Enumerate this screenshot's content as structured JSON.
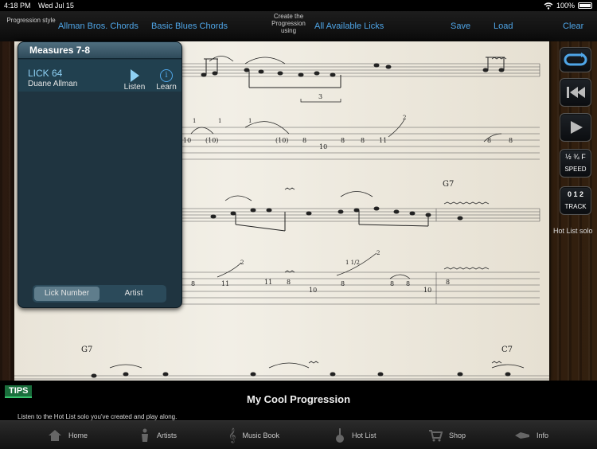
{
  "status": {
    "time": "4:18 PM",
    "date": "Wed Jul 15",
    "battery": "100%"
  },
  "topbar": {
    "progression_label": "Progression style",
    "style_allman": "Allman Bros. Chords",
    "style_blues": "Basic Blues Chords",
    "create_label": "Create the Progression using",
    "all_licks": "All Available Licks",
    "save": "Save",
    "load": "Load",
    "clear": "Clear"
  },
  "sheet": {
    "chord_1": "G7",
    "chord_2": "G7",
    "chord_3": "C7",
    "triplet": "3",
    "tab_row1": [
      "10",
      "(10)",
      "(10)",
      "8",
      "10",
      "8",
      "8",
      "11",
      "8",
      "8"
    ],
    "tab_row2": [
      "8",
      "11",
      "11",
      "8",
      "10",
      "8",
      "8",
      "8",
      "10",
      "8"
    ],
    "bends_row1": [
      "1",
      "1",
      "1",
      "2"
    ],
    "bends_row2": [
      "2",
      "1 1/2",
      "2"
    ]
  },
  "panel": {
    "header": "Measures 7-8",
    "lick_title": "LICK 64",
    "lick_artist": "Duane Allman",
    "listen": "Listen",
    "learn": "Learn",
    "learn_glyph": "i",
    "seg_lick_number": "Lick Number",
    "seg_artist": "Artist"
  },
  "right": {
    "speed_label": "SPEED",
    "speed_values": "½ ¾ F",
    "track_label": "TRACK",
    "track_values": "0 1 2",
    "hotlist_caption": "Hot List solo"
  },
  "footer": {
    "tips": "TIPS",
    "title": "My Cool Progression",
    "tip_text": "Listen to the Hot List solo you've created and play along."
  },
  "tabs": [
    {
      "label": "Home",
      "icon": "home-icon"
    },
    {
      "label": "Artists",
      "icon": "guitarist-icon"
    },
    {
      "label": "Music Book",
      "icon": "treble-clef-icon"
    },
    {
      "label": "Hot List",
      "icon": "guitar-icon"
    },
    {
      "label": "Shop",
      "icon": "cart-icon"
    },
    {
      "label": "Info",
      "icon": "info-icon"
    }
  ],
  "colors": {
    "accent": "#4fa6e8",
    "panel": "#1f3440",
    "tips_green": "#1a6e3c"
  }
}
